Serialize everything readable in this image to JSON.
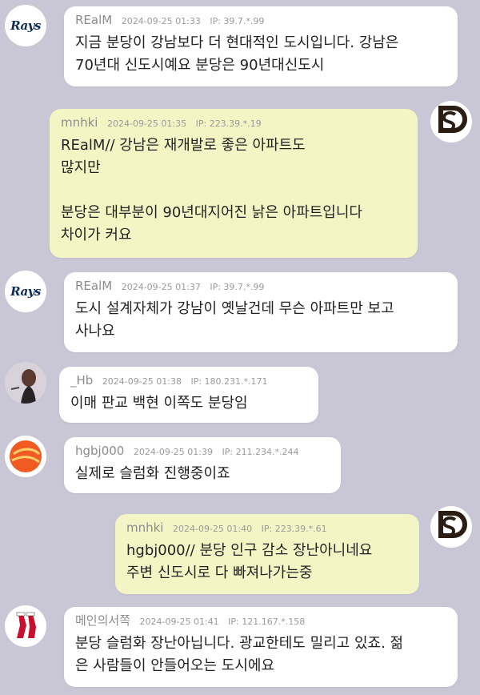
{
  "messages": [
    {
      "nick": "REalM",
      "time": "2024-09-25 01:33",
      "ip": "IP: 39.7.*.99",
      "text": "지금 분당이 강남보다 더 현대적인 도시입니다. 강남은\n70년대 신도시예요 분당은 90년대신도시"
    },
    {
      "nick": "mnhki",
      "time": "2024-09-25 01:35",
      "ip": "IP: 223.39.*.19",
      "text": "REalM// 강남은 재개발로 좋은 아파트도\n많지만\n\n분당은 대부분이 90년대지어진 낡은 아파트입니다\n차이가 커요"
    },
    {
      "nick": "REalM",
      "time": "2024-09-25 01:37",
      "ip": "IP: 39.7.*.99",
      "text": "도시 설계자체가 강남이 옛날건데 무슨 아파트만 보고\n사나요"
    },
    {
      "nick": "_Hb",
      "time": "2024-09-25 01:38",
      "ip": "IP: 180.231.*.171",
      "text": "이매 판교 백현 이쪽도 분당임"
    },
    {
      "nick": "hgbj000",
      "time": "2024-09-25 01:39",
      "ip": "IP: 211.234.*.244",
      "text": "실제로 슬럼화 진행중이죠"
    },
    {
      "nick": "mnhki",
      "time": "2024-09-25 01:40",
      "ip": "IP: 223.39.*.61",
      "text": "hgbj000// 분당 인구 감소 장난아니네요\n주변 신도시로 다 빠져나가는중"
    },
    {
      "nick": "메인의서쪽",
      "time": "2024-09-25 01:41",
      "ip": "IP: 121.167.*.158",
      "text": "분당 슬럼화 장난아닙니다. 광교한테도 밀리고 있죠. 젊\n은 사람들이 안들어오는 도시에요"
    }
  ],
  "avatars": {
    "rays_text": "Rays",
    "padres_text": "SD"
  },
  "colors": {
    "background": "#c9c6d6",
    "bubble_white": "#ffffff",
    "bubble_yellow": "#f3f6c4",
    "rays_navy": "#0b2a55",
    "padres_brown": "#2b1d12",
    "redsox_red": "#c8102e",
    "giants_orange": "#f15a22"
  }
}
